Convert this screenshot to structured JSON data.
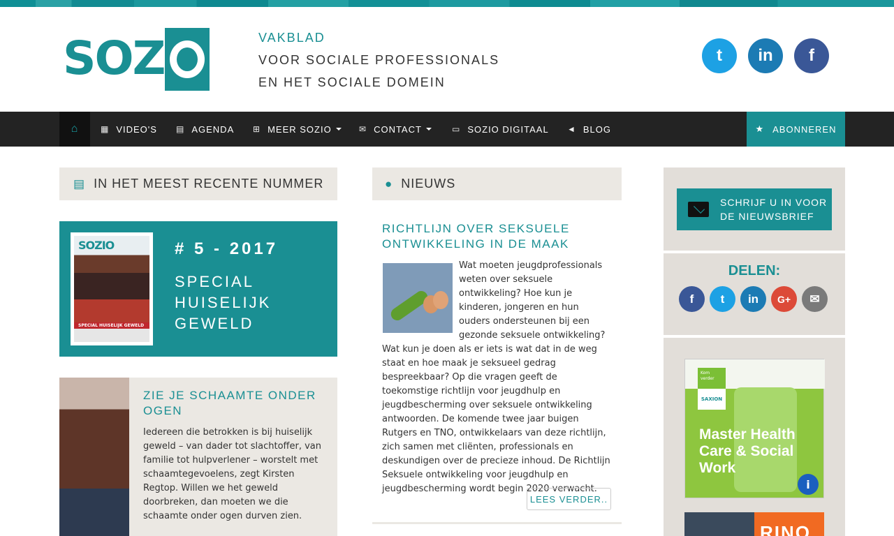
{
  "brand": {
    "logo_text": "SOZIO",
    "tagline_1": "VAKBLAD",
    "tagline_2": "VOOR SOCIALE PROFESSIONALS",
    "tagline_3": "EN HET SOCIALE DOMEIN"
  },
  "header_social": {
    "twitter_label": "t",
    "linkedin_label": "in",
    "facebook_label": "f"
  },
  "nav": {
    "home_icon": "home-icon",
    "items": [
      {
        "label": "VIDEO'S",
        "icon": "film-icon"
      },
      {
        "label": "AGENDA",
        "icon": "calendar-icon"
      },
      {
        "label": "MEER SOZIO",
        "icon": "plus-square-icon"
      },
      {
        "label": "CONTACT",
        "icon": "envelope-icon"
      },
      {
        "label": "SOZIO DIGITAAL",
        "icon": "monitor-icon"
      },
      {
        "label": "BLOG",
        "icon": "megaphone-icon"
      }
    ],
    "subscribe": "ABONNEREN",
    "subscribe_icon": "star-icon"
  },
  "left": {
    "header": "IN HET MEEST RECENTE NUMMER",
    "issue_number": "# 5 - 2017",
    "issue_title": "SPECIAL HUISELIJK GEWELD",
    "cover_logo": "SOZIO",
    "cover_band": "SPECIAL HUISELIJK GEWELD",
    "feature_title": "ZIE JE SCHAAMTE ONDER OGEN",
    "feature_text": "Iedereen die betrokken is bij huiselijk geweld – van dader tot slachtoffer, van familie tot hulpverlener – worstelt met schaamtegevoelens, zegt Kirsten Regtop. Willen we het geweld doorbreken, dan moeten we die schaamte onder ogen durven zien."
  },
  "middle": {
    "header": "NIEUWS",
    "news_title": "RICHTLIJN OVER SEKSUELE ONTWIKKELING IN DE MAAK",
    "news_text": "Wat moeten jeugdprofessionals weten over seksuele ontwikkeling? Hoe kun je kinderen, jongeren en hun ouders ondersteunen bij een gezonde seksuele ontwikkeling? Wat kun je doen als er iets is wat dat in de weg staat en hoe maak je seksueel gedrag bespreekbaar? Op die vragen geeft de toekomstige richtlijn voor jeugdhulp en jeugdbescherming over seksuele ontwikkeling antwoorden. De komende twee jaar buigen Rutgers en TNO, ontwikkelaars van deze richtlijn, zich samen met cliënten, professionals en deskundigen over de precieze inhoud. De Richtlijn Seksuele ontwikkeling voor jeugdhulp en jeugdbescherming wordt begin 2020 verwacht.",
    "read_more": "LEES VERDER.."
  },
  "sidebar": {
    "newsletter": "SCHRIJF U IN VOOR DE NIEUWSBRIEF",
    "share_label": "DELEN:",
    "share": {
      "facebook": "f",
      "twitter": "t",
      "linkedin": "in",
      "googleplus": "G+",
      "email": "✉"
    },
    "ad1_badge": "Kom verder",
    "ad1_brand": "SAXION",
    "ad1_text": "Master Health Care & Social Work",
    "ad1_info": "i",
    "ad2_text": "RINO"
  }
}
